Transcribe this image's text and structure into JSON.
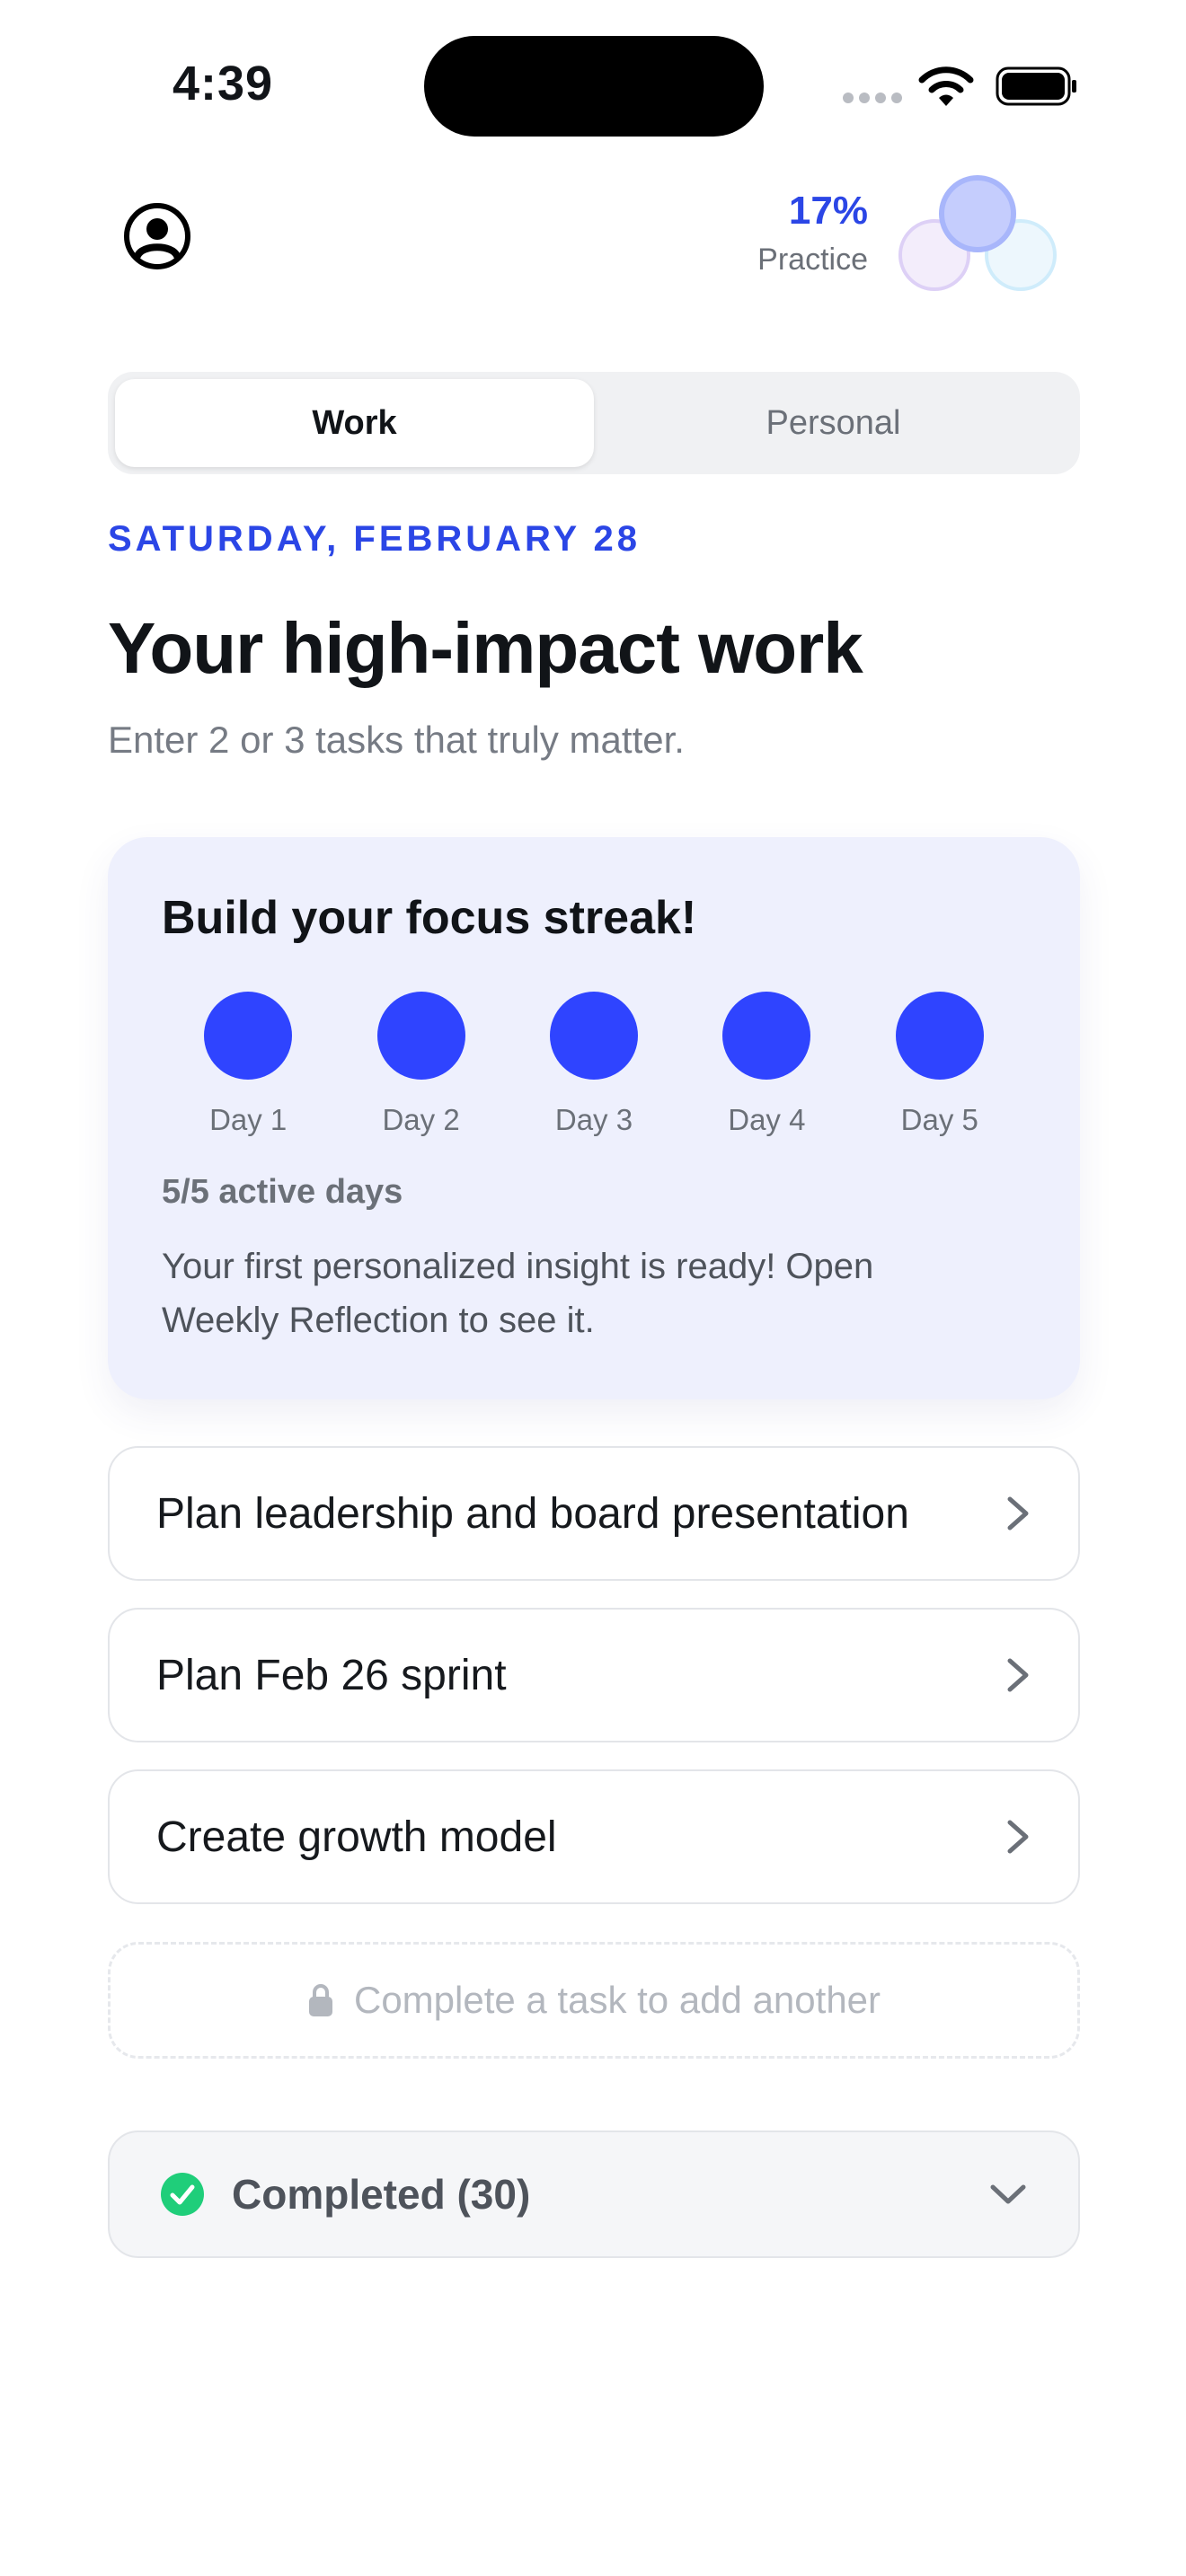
{
  "status_bar": {
    "time": "4:39"
  },
  "header": {
    "practice_percent": "17%",
    "practice_label": "Practice"
  },
  "tabs": [
    {
      "label": "Work",
      "active": true
    },
    {
      "label": "Personal",
      "active": false
    }
  ],
  "date": "SATURDAY, FEBRUARY 28",
  "title": "Your high-impact work",
  "subtitle": "Enter 2 or 3 tasks that truly matter.",
  "streak": {
    "title": "Build your focus streak!",
    "days": [
      {
        "label": "Day 1",
        "active": true
      },
      {
        "label": "Day 2",
        "active": true
      },
      {
        "label": "Day 3",
        "active": true
      },
      {
        "label": "Day 4",
        "active": true
      },
      {
        "label": "Day 5",
        "active": true
      }
    ],
    "active_days": "5/5 active days",
    "insight": "Your first personalized insight is ready! Open Weekly Reflection to see it."
  },
  "tasks": [
    {
      "label": "Plan leadership and board presentation"
    },
    {
      "label": "Plan Feb 26 sprint"
    },
    {
      "label": "Create growth model"
    }
  ],
  "add_task": {
    "label": "Complete a task to add another",
    "locked": true
  },
  "completed": {
    "label": "Completed (30)"
  },
  "colors": {
    "accent": "#2b46e6",
    "streak_dot": "#2f44ff",
    "streak_card": "#eef0fd",
    "success": "#1fce7a"
  },
  "icons": {
    "profile": "profile-icon",
    "wifi": "wifi-icon",
    "battery": "battery-icon",
    "chevron_right": "chevron-right-icon",
    "lock": "lock-icon",
    "check": "check-circle-icon",
    "chevron_down": "chevron-down-icon"
  }
}
